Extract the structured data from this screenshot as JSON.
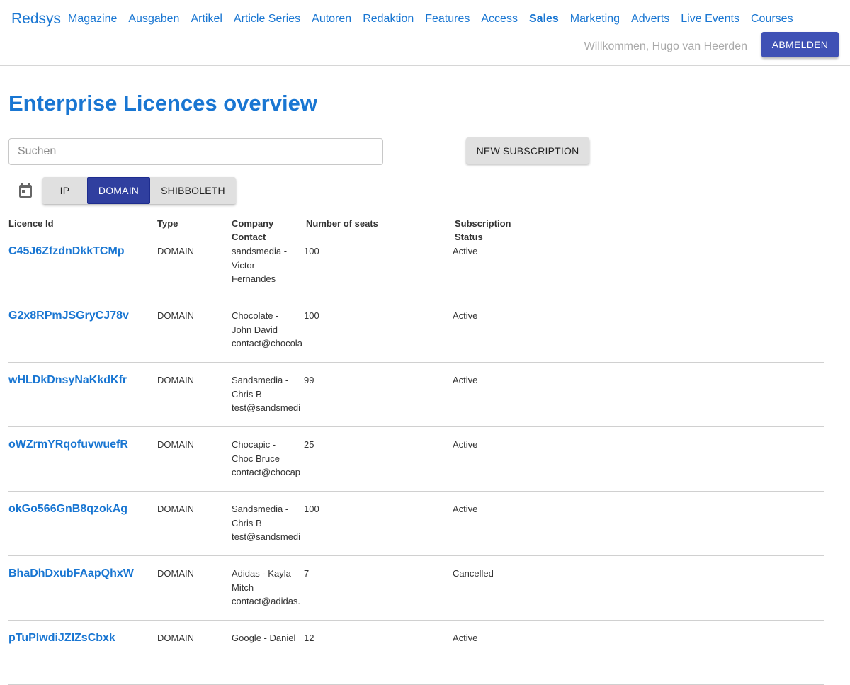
{
  "header": {
    "brand": "Redsys",
    "nav": [
      "Magazine",
      "Ausgaben",
      "Artikel",
      "Article Series",
      "Autoren",
      "Redaktion",
      "Features",
      "Access",
      "Sales",
      "Marketing",
      "Adverts",
      "Live Events",
      "Courses"
    ],
    "active_nav": "Sales",
    "welcome": "Willkommen, Hugo van Heerden",
    "logout_label": "ABMELDEN"
  },
  "page": {
    "title": "Enterprise Licences overview"
  },
  "search": {
    "placeholder": "Suchen",
    "value": ""
  },
  "actions": {
    "new_subscription": "NEW SUBSCRIPTION"
  },
  "filters": {
    "calendar_icon": "calendar-icon",
    "options": [
      "IP",
      "DOMAIN",
      "SHIBBOLETH"
    ],
    "selected": "DOMAIN"
  },
  "table": {
    "headers": {
      "licence_id": "Licence Id",
      "type": "Type",
      "company_contact": "Company Contact",
      "seats": "Number of seats",
      "status": "Subscription Status"
    },
    "rows": [
      {
        "id": "C45J6ZfzdnDkkTCMp",
        "type": "DOMAIN",
        "contact": "sandsmedia -\nVictor\nFernandes",
        "seats": "100",
        "status": "Active"
      },
      {
        "id": "G2x8RPmJSGryCJ78v",
        "type": "DOMAIN",
        "contact": "Chocolate -\nJohn David\ncontact@chocola",
        "seats": "100",
        "status": "Active"
      },
      {
        "id": "wHLDkDnsyNaKkdKfr",
        "type": "DOMAIN",
        "contact": "Sandsmedia -\nChris B\ntest@sandsmedi",
        "seats": "99",
        "status": "Active"
      },
      {
        "id": "oWZrmYRqofuvwuefR",
        "type": "DOMAIN",
        "contact": "Chocapic -\nChoc Bruce\ncontact@chocap",
        "seats": "25",
        "status": "Active"
      },
      {
        "id": "okGo566GnB8qzokAg",
        "type": "DOMAIN",
        "contact": "Sandsmedia -\nChris B\ntest@sandsmedi",
        "seats": "100",
        "status": "Active"
      },
      {
        "id": "BhaDhDxubFAapQhxW",
        "type": "DOMAIN",
        "contact": "Adidas - Kayla\nMitch\ncontact@adidas.",
        "seats": "7",
        "status": "Cancelled"
      },
      {
        "id": "pTuPlwdiJZIZsCbxk",
        "type": "DOMAIN",
        "contact": "Google - Daniel",
        "seats": "12",
        "status": "Active"
      }
    ]
  },
  "colors": {
    "link": "#1976d2",
    "primary_button": "#3f51b5",
    "selected_filter": "#303f9f",
    "muted_text": "#a9a9a9"
  }
}
